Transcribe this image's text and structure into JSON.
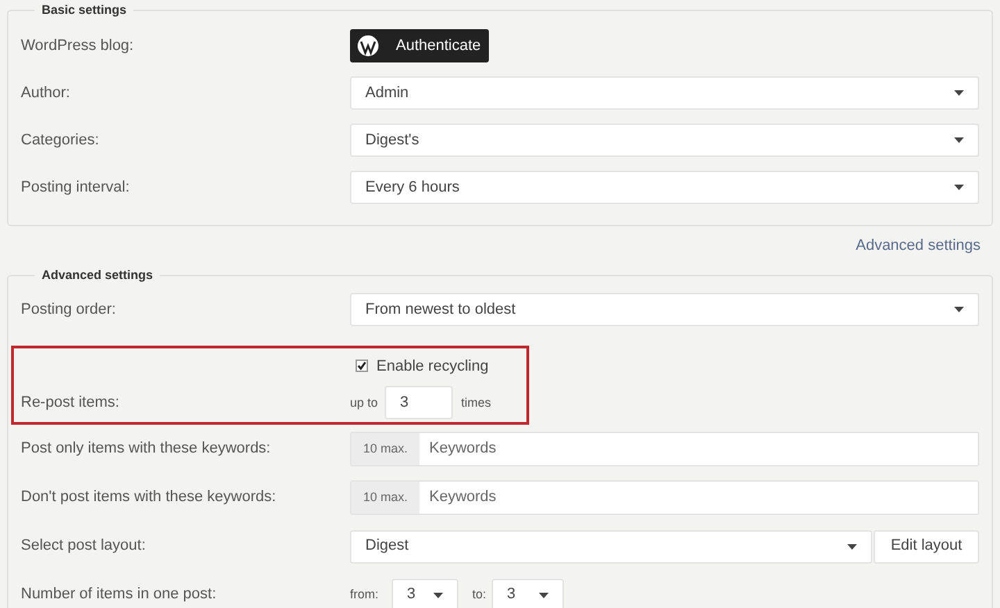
{
  "basic_settings": {
    "title": "Basic settings",
    "rows": [
      {
        "label": "WordPress blog:",
        "kind": "button",
        "value": "Authenticate"
      },
      {
        "label": "Author:",
        "kind": "select",
        "value": "Admin"
      },
      {
        "label": "Categories:",
        "kind": "select",
        "value": "Digest's"
      },
      {
        "label": "Posting interval:",
        "kind": "select",
        "value": "Every 6 hours"
      }
    ]
  },
  "advanced_link": "Advanced settings",
  "advanced_settings": {
    "title": "Advanced settings",
    "rows": [
      {
        "label": "Posting order:",
        "kind": "select",
        "value": "From newest to oldest"
      },
      {
        "kind": "recycling",
        "highlighted": true,
        "checkbox": {
          "label": "Enable recycling",
          "checked": true
        },
        "label": "Re-post items:",
        "prefix": "up to",
        "value": "3",
        "suffix": "times"
      },
      {
        "label": "Post only items with these keywords:",
        "kind": "keywords",
        "addon": "10 max.",
        "placeholder": "Keywords"
      },
      {
        "label": "Don't post items with these keywords:",
        "kind": "keywords",
        "addon": "10 max.",
        "placeholder": "Keywords"
      },
      {
        "label": "Select post layout:",
        "kind": "layout",
        "value": "Digest",
        "button": "Edit layout"
      },
      {
        "label": "Number of items in one post:",
        "kind": "range",
        "from_label": "from:",
        "from": "3",
        "to_label": "to:",
        "to": "3"
      }
    ]
  }
}
